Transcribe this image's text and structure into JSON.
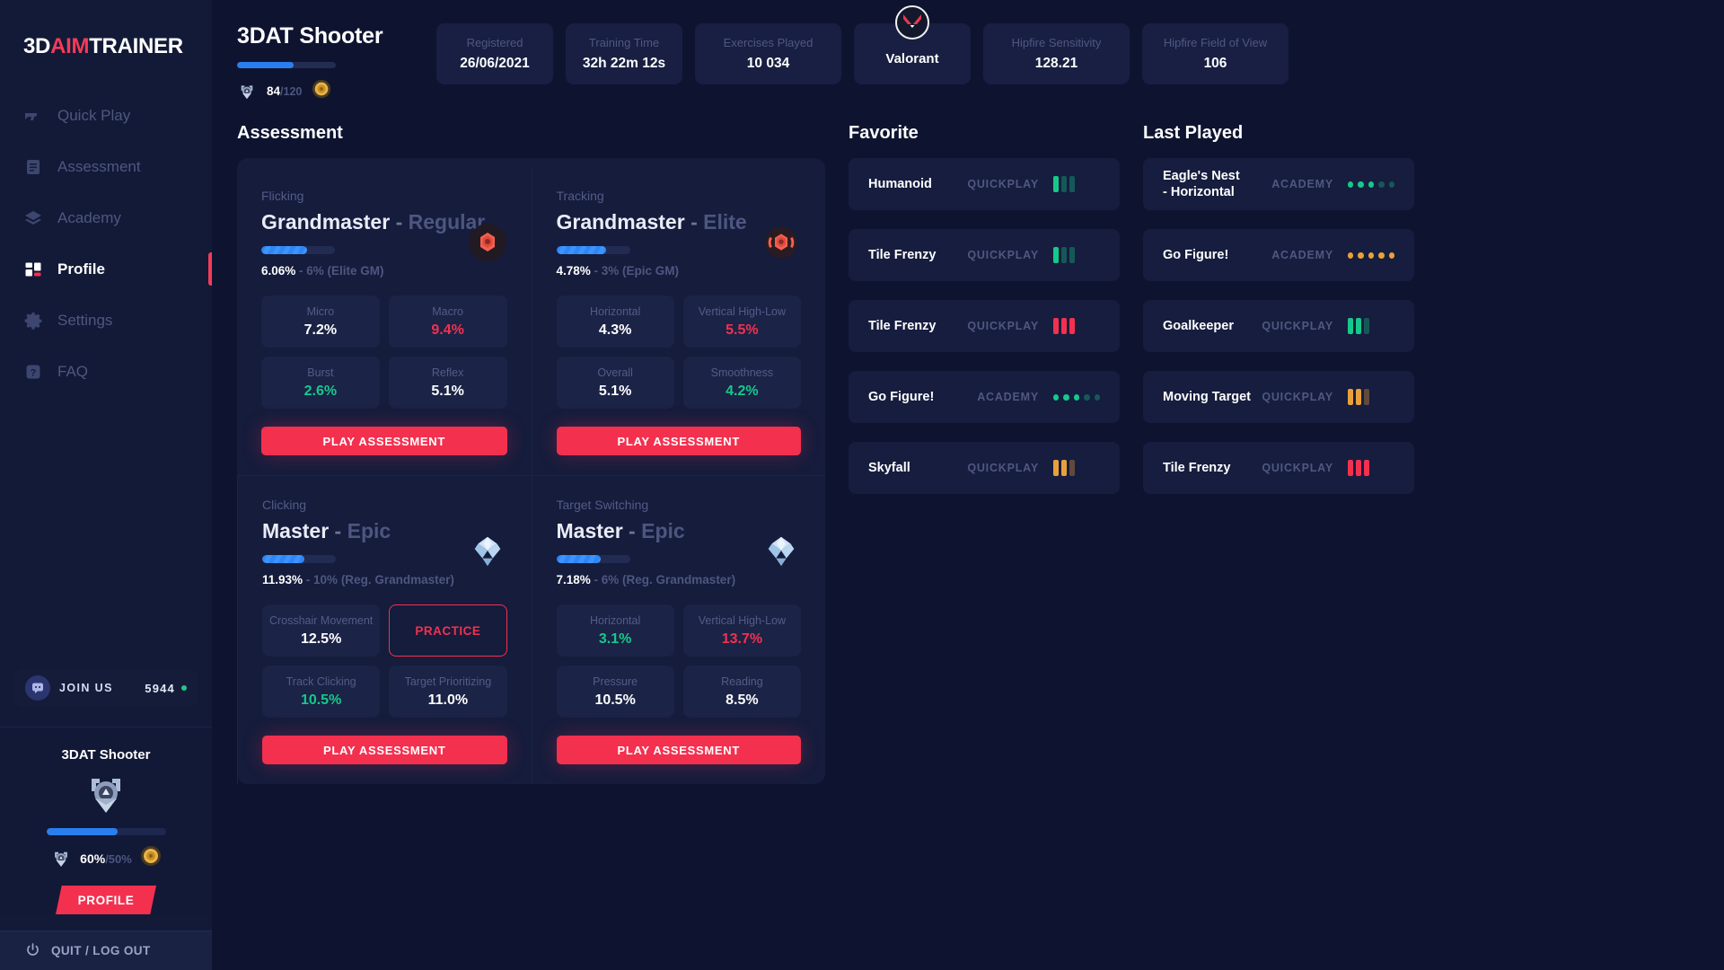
{
  "brand": {
    "part1": "3D",
    "part2": "AIM",
    "part3": "TRAINER"
  },
  "sidebar": {
    "nav": [
      {
        "label": "Quick Play",
        "icon": "pistol-icon",
        "active": false
      },
      {
        "label": "Assessment",
        "icon": "document-icon",
        "active": false
      },
      {
        "label": "Academy",
        "icon": "layers-icon",
        "active": false
      },
      {
        "label": "Profile",
        "icon": "grid-icon",
        "active": true
      },
      {
        "label": "Settings",
        "icon": "gear-icon",
        "active": false
      },
      {
        "label": "FAQ",
        "icon": "question-icon",
        "active": false
      }
    ],
    "discord": {
      "label": "JOIN US",
      "count": "5944",
      "icon": "discord-icon"
    },
    "profile_panel": {
      "title": "3DAT Shooter",
      "progress_percent": 60,
      "percent_text": "60%",
      "percent_goal": "/50%",
      "button_label": "PROFILE",
      "rank_icon": "shooter-rank-icon",
      "coin_icon": "gold-coin-icon"
    },
    "quit": {
      "label": "QUIT / LOG OUT",
      "icon": "power-icon"
    }
  },
  "header": {
    "username": "3DAT Shooter",
    "level_progress_percent": 57,
    "level_current": "84",
    "level_max": "/120",
    "level_icon": "shooter-rank-icon",
    "coin_icon": "gold-coin-icon",
    "stats": [
      {
        "label": "Registered",
        "value": "26/06/2021"
      },
      {
        "label": "Training Time",
        "value": "32h 22m 12s"
      },
      {
        "label": "Exercises Played",
        "value": "10 034"
      }
    ],
    "game": {
      "name": "Valorant",
      "icon": "valorant-icon"
    },
    "settings": [
      {
        "label": "Hipfire Sensitivity",
        "value": "128.21"
      },
      {
        "label": "Hipfire Field of View",
        "value": "106"
      }
    ]
  },
  "assessment": {
    "title": "Assessment",
    "play_label": "PLAY ASSESSMENT",
    "cards": [
      {
        "skill": "Flicking",
        "rank_main": "Grandmaster",
        "rank_dash": "-",
        "rank_sub": "Regular",
        "progress_percent": 62,
        "pct_value": "6.06%",
        "pct_rest": "- 6% (Elite GM)",
        "emblem": "grandmaster-emblem",
        "emblem_style": "gm",
        "subs": [
          {
            "label": "Micro",
            "value": "7.2%",
            "trend": "none"
          },
          {
            "label": "Macro",
            "value": "9.4%",
            "trend": "down"
          },
          {
            "label": "Burst",
            "value": "2.6%",
            "trend": "up"
          },
          {
            "label": "Reflex",
            "value": "5.1%",
            "trend": "none"
          }
        ]
      },
      {
        "skill": "Tracking",
        "rank_main": "Grandmaster",
        "rank_dash": "-",
        "rank_sub": "Elite",
        "progress_percent": 68,
        "pct_value": "4.78%",
        "pct_rest": "- 3% (Epic GM)",
        "emblem": "grandmaster-elite-emblem",
        "emblem_style": "gme",
        "subs": [
          {
            "label": "Horizontal",
            "value": "4.3%",
            "trend": "none"
          },
          {
            "label": "Vertical High-Low",
            "value": "5.5%",
            "trend": "down"
          },
          {
            "label": "Overall",
            "value": "5.1%",
            "trend": "none"
          },
          {
            "label": "Smoothness",
            "value": "4.2%",
            "trend": "up"
          }
        ]
      },
      {
        "skill": "Clicking",
        "rank_main": "Master",
        "rank_dash": "-",
        "rank_sub": "Epic",
        "progress_percent": 57,
        "pct_value": "11.93%",
        "pct_rest": "- 10% (Reg. Grandmaster)",
        "emblem": "master-epic-emblem",
        "emblem_style": "master",
        "subs": [
          {
            "label": "Crosshair Movement",
            "value": "12.5%",
            "trend": "none"
          },
          {
            "label": "PRACTICE",
            "value": "",
            "trend": "practice"
          },
          {
            "label": "Track Clicking",
            "value": "10.5%",
            "trend": "up"
          },
          {
            "label": "Target Prioritizing",
            "value": "11.0%",
            "trend": "none"
          }
        ]
      },
      {
        "skill": "Target Switching",
        "rank_main": "Master",
        "rank_dash": "-",
        "rank_sub": "Epic",
        "progress_percent": 60,
        "pct_value": "7.18%",
        "pct_rest": "- 6% (Reg. Grandmaster)",
        "emblem": "master-epic-emblem",
        "emblem_style": "master",
        "subs": [
          {
            "label": "Horizontal",
            "value": "3.1%",
            "trend": "up"
          },
          {
            "label": "Vertical High-Low",
            "value": "13.7%",
            "trend": "down"
          },
          {
            "label": "Pressure",
            "value": "10.5%",
            "trend": "none"
          },
          {
            "label": "Reading",
            "value": "8.5%",
            "trend": "none"
          }
        ]
      }
    ]
  },
  "favorite": {
    "title": "Favorite",
    "items": [
      {
        "name": "Humanoid",
        "mode": "QUICKPLAY",
        "meter": "bars",
        "count": 3,
        "filled": 1,
        "color": "#15c98a"
      },
      {
        "name": "Tile Frenzy",
        "mode": "QUICKPLAY",
        "meter": "bars",
        "count": 3,
        "filled": 1,
        "color": "#15c98a"
      },
      {
        "name": "Tile Frenzy",
        "mode": "QUICKPLAY",
        "meter": "bars",
        "count": 3,
        "filled": 3,
        "color": "#f4304f"
      },
      {
        "name": "Go Figure!",
        "mode": "ACADEMY",
        "meter": "dots",
        "count": 5,
        "filled": 3,
        "color": "#15c98a"
      },
      {
        "name": "Skyfall",
        "mode": "QUICKPLAY",
        "meter": "bars",
        "count": 3,
        "filled": 2,
        "color": "#e8a13a"
      }
    ]
  },
  "last_played": {
    "title": "Last Played",
    "items": [
      {
        "name": "Eagle's Nest\n- Horizontal",
        "mode": "ACADEMY",
        "meter": "dots",
        "count": 5,
        "filled": 3,
        "color": "#15c98a"
      },
      {
        "name": "Go Figure!",
        "mode": "ACADEMY",
        "meter": "dots",
        "count": 5,
        "filled": 5,
        "color": "#e8a13a"
      },
      {
        "name": "Goalkeeper",
        "mode": "QUICKPLAY",
        "meter": "bars",
        "count": 3,
        "filled": 2,
        "color": "#15c98a"
      },
      {
        "name": "Moving Target",
        "mode": "QUICKPLAY",
        "meter": "bars",
        "count": 3,
        "filled": 2,
        "color": "#e8a13a"
      },
      {
        "name": "Tile Frenzy",
        "mode": "QUICKPLAY",
        "meter": "bars",
        "count": 3,
        "filled": 3,
        "color": "#f4304f"
      }
    ]
  },
  "colors": {
    "accent_red": "#f4304f",
    "accent_blue": "#2a7fef",
    "green": "#15c98a",
    "orange": "#e8a13a",
    "bg": "#0e1430",
    "panel": "#151c3c"
  }
}
